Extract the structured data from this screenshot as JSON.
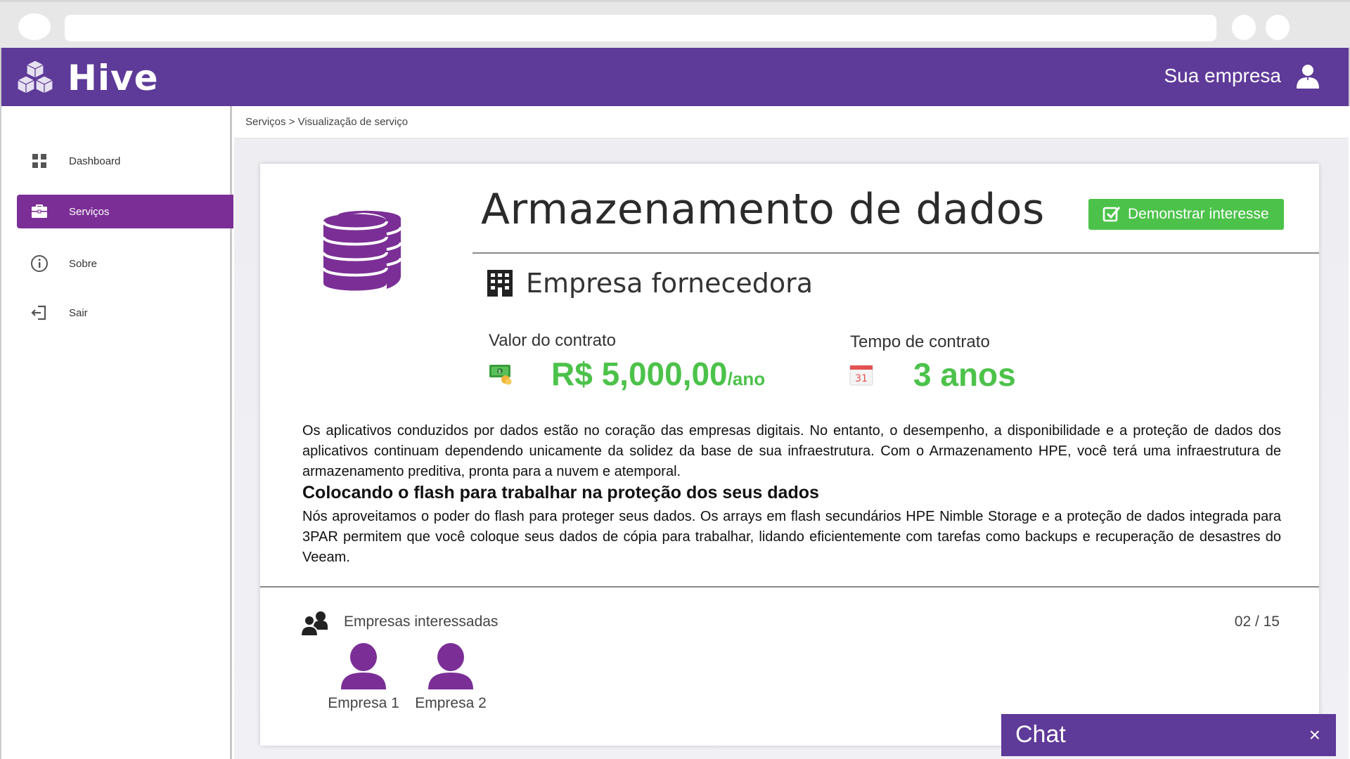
{
  "app": {
    "name": "Hive",
    "account_label": "Sua empresa"
  },
  "colors": {
    "brand": "#5e3a99",
    "accent": "#7b2f96",
    "success": "#4cc24a"
  },
  "sidebar": {
    "items": [
      {
        "label": "Dashboard",
        "icon": "grid-icon",
        "active": false
      },
      {
        "label": "Serviços",
        "icon": "briefcase-icon",
        "active": true
      },
      {
        "label": "Sobre",
        "icon": "info-icon",
        "active": false
      },
      {
        "label": "Sair",
        "icon": "logout-icon",
        "active": false
      }
    ]
  },
  "breadcrumb": "Serviços > Visualização de serviço",
  "service": {
    "title": "Armazenamento de dados",
    "interest_button": "Demonstrar interesse",
    "provider": "Empresa fornecedora",
    "contract_value_label": "Valor do contrato",
    "contract_value": "R$ 5,000,00",
    "contract_value_unit": "/ano",
    "contract_time_label": "Tempo de contrato",
    "contract_time": "3 anos",
    "calendar_day": "31",
    "description": "Os aplicativos conduzidos por dados estão no coração das empresas digitais. No entanto, o desempenho, a disponibilidade e a proteção de dados dos aplicativos continuam dependendo unicamente da solidez da base de sua infraestrutura. Com o Armazenamento HPE, você terá uma infraestrutura de armazenamento preditiva, pronta para a nuvem e atemporal.",
    "section_heading": "Colocando o flash para trabalhar na proteção dos seus dados",
    "section_text": "Nós aproveitamos o poder do flash para proteger seus dados. Os arrays em flash secundários HPE Nimble Storage e a proteção de dados integrada para 3PAR permitem que você coloque seus dados de cópia para trabalhar, lidando eficientemente com tarefas como backups e recuperação de desastres do Veeam."
  },
  "interested": {
    "label": "Empresas interessadas",
    "count": "02 / 15",
    "companies": [
      "Empresa 1",
      "Empresa 2"
    ]
  },
  "chat": {
    "title": "Chat",
    "close": "×"
  }
}
